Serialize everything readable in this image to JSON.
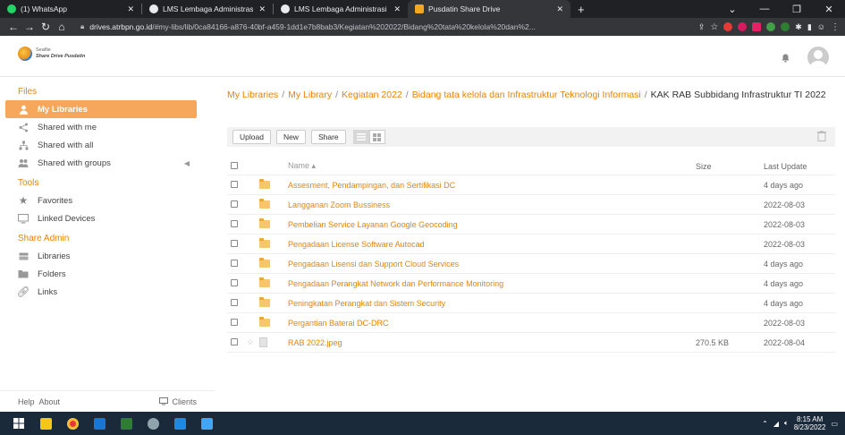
{
  "browser": {
    "tabs": [
      {
        "title": "(1) WhatsApp",
        "favicon_color": "#25d366",
        "active": false
      },
      {
        "title": "LMS Lembaga Administrasi Nega",
        "favicon_color": "#e8eaed",
        "active": false
      },
      {
        "title": "LMS Lembaga Administrasi Nega",
        "favicon_color": "#e8eaed",
        "active": false
      },
      {
        "title": "Pusdatin Share Drive",
        "favicon_color": "#f5a623",
        "active": true
      }
    ],
    "url_domain": "drives.atrbpn.go.id",
    "url_path": "/#my-libs/lib/0ca84166-a876-40bf-a459-1dd1e7b8bab3/Kegiatan%202022/Bidang%20tata%20kelola%20dan%2..."
  },
  "app": {
    "logo_line1": "Seafile",
    "logo_line2": "Share Drive Pusdatin"
  },
  "sidebar": {
    "files_header": "Files",
    "files_items": [
      {
        "label": "My Libraries",
        "active": true
      },
      {
        "label": "Shared with me",
        "active": false
      },
      {
        "label": "Shared with all",
        "active": false
      },
      {
        "label": "Shared with groups",
        "active": false
      }
    ],
    "tools_header": "Tools",
    "tools_items": [
      {
        "label": "Favorites"
      },
      {
        "label": "Linked Devices"
      }
    ],
    "admin_header": "Share Admin",
    "admin_items": [
      {
        "label": "Libraries"
      },
      {
        "label": "Folders"
      },
      {
        "label": "Links"
      }
    ],
    "footer_help": "Help",
    "footer_about": "About",
    "footer_clients": "Clients"
  },
  "breadcrumb": {
    "items": [
      "My Libraries",
      "My Library",
      "Kegiatan 2022",
      "Bidang tata kelola dan Infrastruktur Teknologi Informasi"
    ],
    "current": "KAK RAB Subbidang Infrastruktur TI 2022"
  },
  "toolbar": {
    "upload": "Upload",
    "new": "New",
    "share": "Share"
  },
  "table": {
    "col_name": "Name ▴",
    "col_size": "Size",
    "col_update": "Last Update",
    "rows": [
      {
        "type": "folder",
        "name": "Assesment, Pendampingan, dan Sertifikasi DC",
        "size": "",
        "updated": "4 days ago"
      },
      {
        "type": "folder",
        "name": "Langganan Zoom Bussiness",
        "size": "",
        "updated": "2022-08-03"
      },
      {
        "type": "folder",
        "name": "Pembelian Service Layanan Google Geocoding",
        "size": "",
        "updated": "2022-08-03"
      },
      {
        "type": "folder",
        "name": "Pengadaan License Software Autocad",
        "size": "",
        "updated": "2022-08-03"
      },
      {
        "type": "folder",
        "name": "Pengadaan Lisensi dan Support Cloud Services",
        "size": "",
        "updated": "4 days ago"
      },
      {
        "type": "folder",
        "name": "Pengadaan Perangkat Network dan Performance Monitoring",
        "size": "",
        "updated": "4 days ago"
      },
      {
        "type": "folder",
        "name": "Peningkatan Perangkat dan Sistem Security",
        "size": "",
        "updated": "4 days ago"
      },
      {
        "type": "folder",
        "name": "Pergantian Baterai DC-DRC",
        "size": "",
        "updated": "2022-08-03"
      },
      {
        "type": "file",
        "name": "RAB 2022.jpeg",
        "size": "270.5 KB",
        "updated": "2022-08-04"
      }
    ]
  },
  "taskbar": {
    "time": "8:15 AM",
    "date": "8/23/2022"
  },
  "colors": {
    "accent": "#eb8205",
    "active_nav": "#f6a75b"
  }
}
